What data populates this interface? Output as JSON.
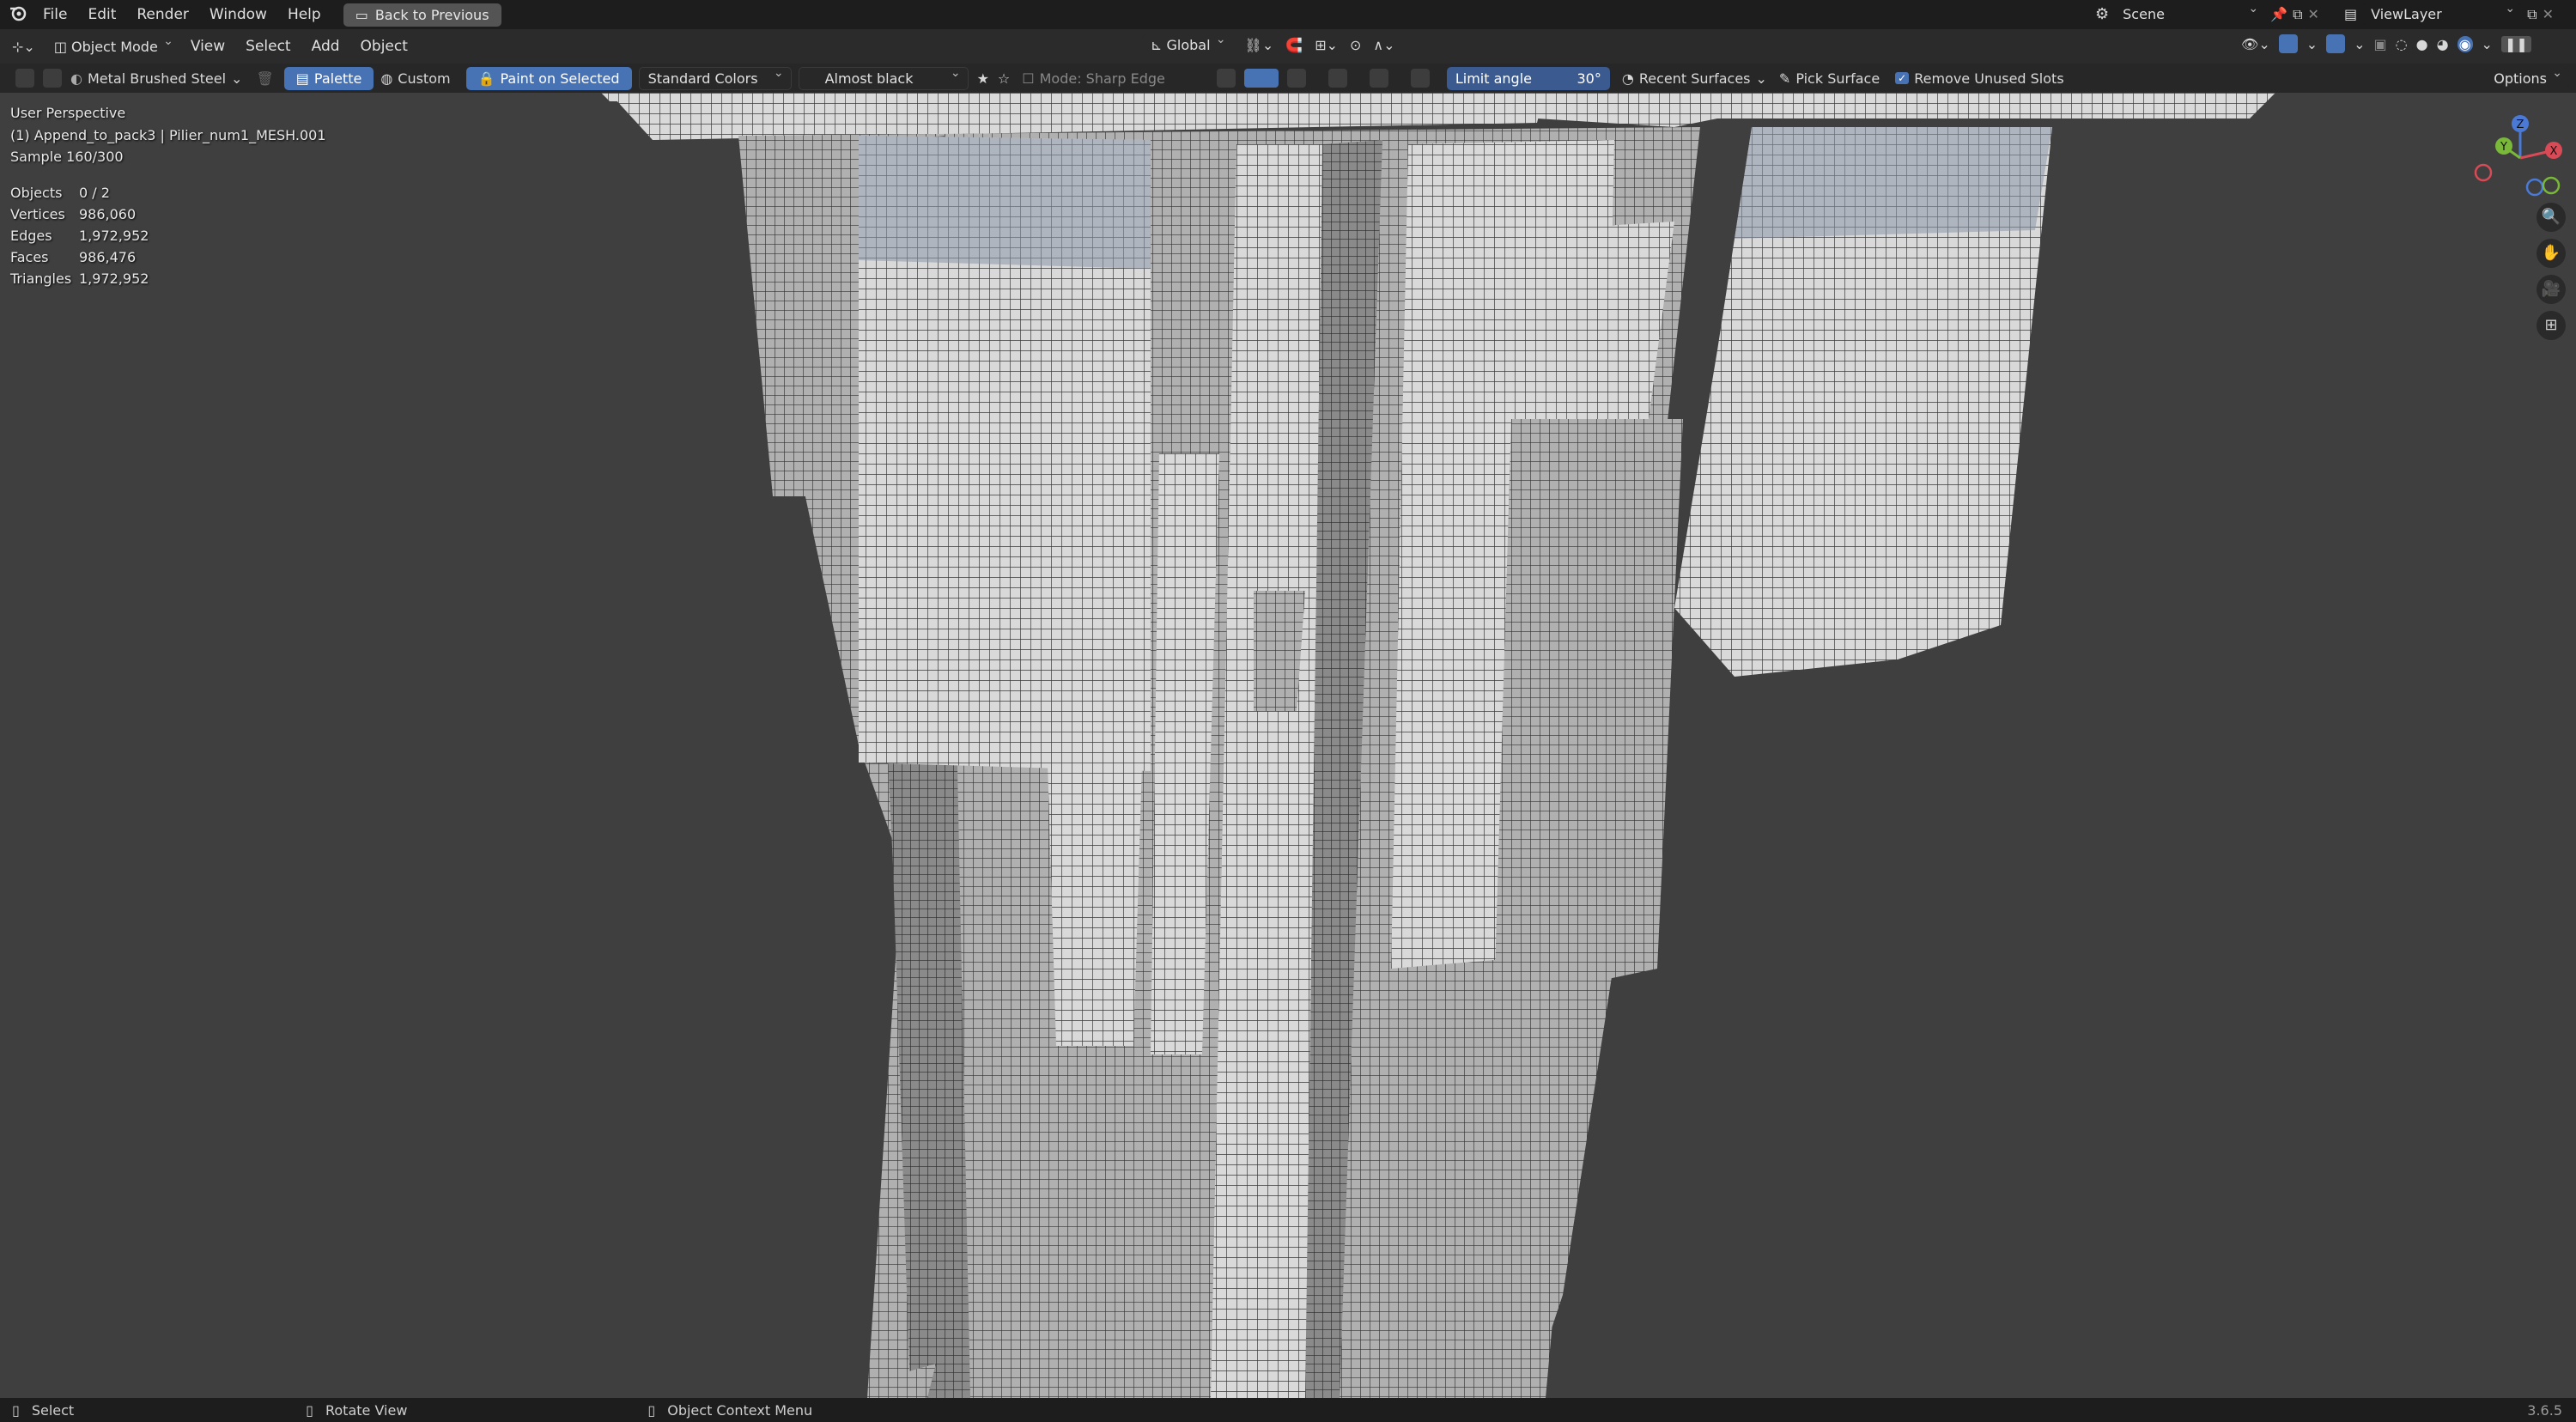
{
  "top_menu": {
    "items": [
      "File",
      "Edit",
      "Render",
      "Window",
      "Help"
    ],
    "back_button": "Back to Previous",
    "scene_label": "Scene",
    "view_layer_label": "ViewLayer"
  },
  "header": {
    "mode": "Object Mode",
    "menus": [
      "View",
      "Select",
      "Add",
      "Object"
    ],
    "transform_orientation": "Global"
  },
  "tool_settings": {
    "material": "Metal Brushed Steel",
    "palette": "Palette",
    "custom": "Custom",
    "paint_on_selected": "Paint on Selected",
    "color_set": "Standard Colors",
    "color": "Almost black",
    "mode_label": "Mode: Sharp Edge",
    "limit_angle_label": "Limit angle",
    "limit_angle_value": "30°",
    "recent_surfaces": "Recent Surfaces",
    "pick_surface": "Pick Surface",
    "remove_unused_slots": "Remove Unused Slots",
    "remove_unused_checked": true,
    "options": "Options"
  },
  "viewport": {
    "perspective": "User Perspective",
    "object_info": "(1) Append_to_pack3 | Pilier_num1_MESH.001",
    "sample": "Sample 160/300",
    "stats": [
      {
        "label": "Objects",
        "value": "0 / 2"
      },
      {
        "label": "Vertices",
        "value": "986,060"
      },
      {
        "label": "Edges",
        "value": "1,972,952"
      },
      {
        "label": "Faces",
        "value": "986,476"
      },
      {
        "label": "Triangles",
        "value": "1,972,952"
      }
    ]
  },
  "gizmo": {
    "x": "X",
    "y": "Y",
    "z": "Z"
  },
  "status_bar": {
    "select": "Select",
    "rotate": "Rotate View",
    "context": "Object Context Menu",
    "version": "3.6.5"
  }
}
